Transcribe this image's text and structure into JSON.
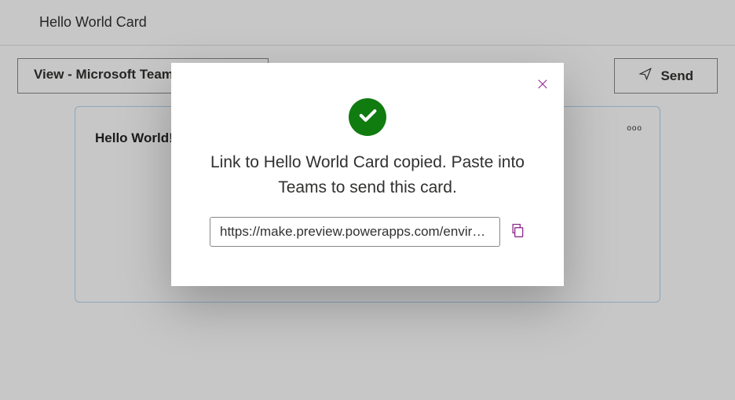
{
  "header": {
    "title": "Hello World Card"
  },
  "topbar": {
    "view_label": "View - Microsoft Teams -",
    "send_label": "Send"
  },
  "card": {
    "title": "Hello World!",
    "menu_glyph": "ooo"
  },
  "modal": {
    "message": "Link to Hello World Card copied. Paste into Teams to send this card.",
    "url_value": "https://make.preview.powerapps.com/envir…"
  }
}
